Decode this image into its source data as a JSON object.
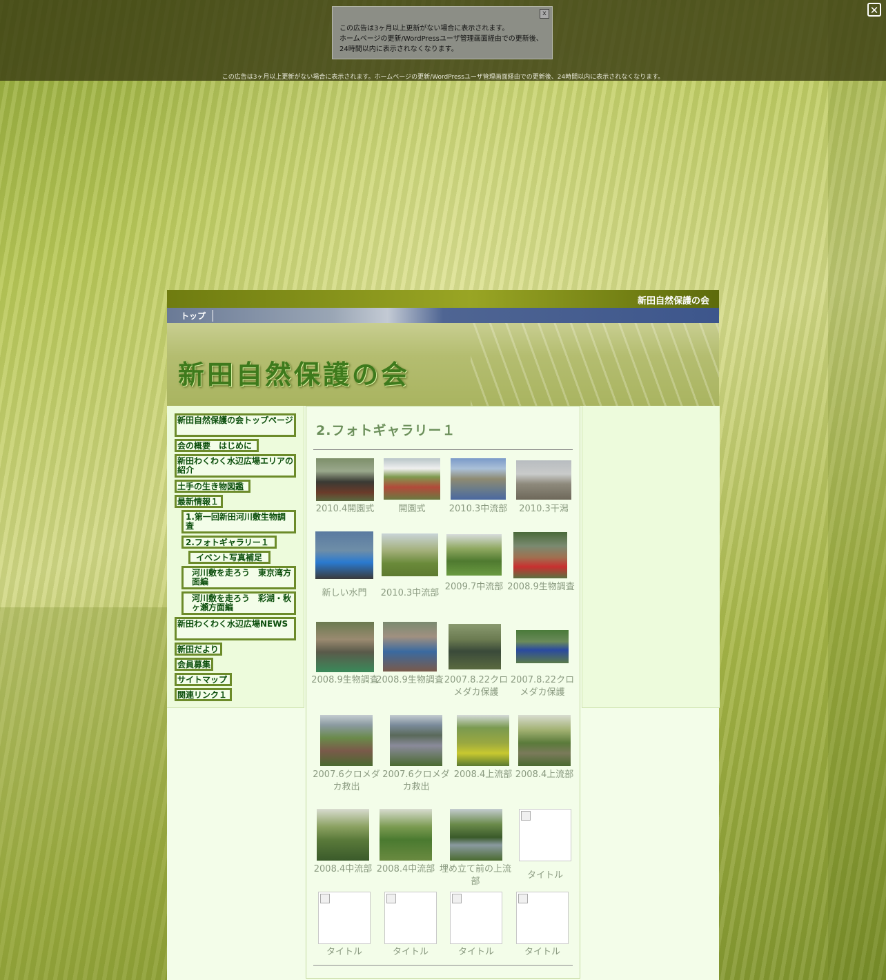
{
  "ad": {
    "box_line1": "この広告は3ヶ月以上更新がない場合に表示されます。",
    "box_line2": "ホームページの更新/WordPressユーザ管理画面経由での更新後、",
    "box_line3": "24時間以内に表示されなくなります。",
    "box_close": "x",
    "strip": "この広告は3ヶ月以上更新がない場合に表示されます。ホームページの更新/WordPressユーザ管理画面経由での更新後、24時間以内に表示されなくなります。",
    "main_close": "✕"
  },
  "header": {
    "site_name": "新田自然保護の会",
    "nav_top": "トップ",
    "banner_title": "新田自然保護の会"
  },
  "menu": [
    "新田自然保護の会トップページ",
    "会の概要　はじめに",
    "新田わくわく水辺広場エリアの紹介",
    "土手の生き物図鑑",
    "最新情報１",
    "1.第一回新田河川敷生物調査",
    "2.フォトギャラリー１",
    "イベント写真補足",
    "河川敷を走ろう　東京湾方面編",
    "河川敷を走ろう　彩湖・秋ヶ瀬方面編",
    "新田わくわく水辺広場NEWS",
    "新田だより",
    "会員募集",
    "サイトマップ",
    "関連リンク１"
  ],
  "page": {
    "title": "2.フォトギャラリー１"
  },
  "gallery": [
    {
      "caption": "2010.4開園式",
      "photo": "ceremony"
    },
    {
      "caption": "開園式",
      "photo": "ceremony-crowd"
    },
    {
      "caption": "2010.3中流部",
      "photo": "riverbank-city"
    },
    {
      "caption": "2010.3干潟",
      "photo": "mudflat"
    },
    {
      "caption": "新しい水門",
      "photo": "water-gate"
    },
    {
      "caption": "2010.3中流部",
      "photo": "willow-field"
    },
    {
      "caption": "2009.7中流部",
      "photo": "green-trees"
    },
    {
      "caption": "2008.9生物調査",
      "photo": "survey-people"
    },
    {
      "caption": "2008.9生物調査",
      "photo": "survey-net"
    },
    {
      "caption": "2008.9生物調査",
      "photo": "survey-group"
    },
    {
      "caption": "2007.8.22クロメダカ保護",
      "photo": "medaka-group"
    },
    {
      "caption": "2007.8.22クロメダカ保護",
      "photo": "medaka-reeds"
    },
    {
      "caption": "2007.6クロメダカ救出",
      "photo": "rescue-crowd"
    },
    {
      "caption": "2007.6クロメダカ救出",
      "photo": "rescue-ditch"
    },
    {
      "caption": "2008.4上流部",
      "photo": "flower-field"
    },
    {
      "caption": "2008.4上流部",
      "photo": "willow-pond"
    },
    {
      "caption": "2008.4中流部",
      "photo": "willow-path"
    },
    {
      "caption": "2008.4中流部",
      "photo": "willow-grass"
    },
    {
      "caption": "埋め立て前の上流部",
      "photo": "creek"
    },
    {
      "caption": "タイトル",
      "photo": "broken"
    },
    {
      "caption": "タイトル",
      "photo": "broken"
    },
    {
      "caption": "タイトル",
      "photo": "broken"
    },
    {
      "caption": "タイトル",
      "photo": "broken"
    },
    {
      "caption": "タイトル",
      "photo": "broken"
    }
  ],
  "colors": {
    "menu_border": "#6c8b2a",
    "menu_text": "#0b4e0b",
    "title_green": "#6b8f5a",
    "caption_gray": "#8a9a80"
  }
}
